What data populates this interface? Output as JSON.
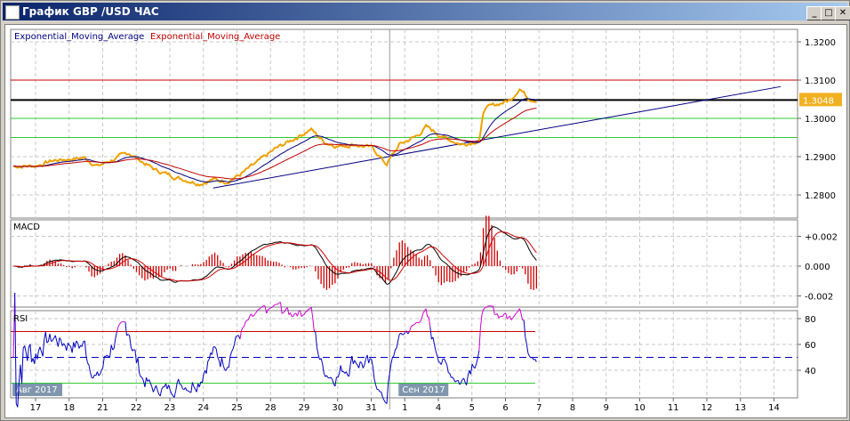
{
  "window": {
    "title": "График GBP /USD  ЧАС",
    "minimize": "_",
    "maximize": "□",
    "close": "✕"
  },
  "colors": {
    "price": "#f0a000",
    "ema_fast": "#000080",
    "ema_slow": "#c00000",
    "rsi_high": "#d000d0",
    "green": "#33cc33",
    "red": "#cc0000"
  },
  "legend": {
    "ema1": "Exponential_Moving_Average",
    "ema2": "Exponential_Moving_Average"
  },
  "chart_data": [
    {
      "type": "line",
      "title": "GBP/USD hourly",
      "ylim": [
        1.277,
        1.3235
      ],
      "yticks": [
        "1.3200",
        "1.3100",
        "1.3000",
        "1.2900",
        "1.2800"
      ],
      "current_price": "1.3048",
      "hlines": [
        {
          "value": 1.31,
          "color": "#cc0000"
        },
        {
          "value": 1.3048,
          "color": "#000000"
        },
        {
          "value": 1.3,
          "color": "#33cc33"
        },
        {
          "value": 1.295,
          "color": "#33cc33"
        }
      ],
      "trendline": [
        [
          5.29,
          1.2818
        ],
        [
          22.2,
          1.3083
        ]
      ],
      "price_points": [
        [
          -0.66,
          1.2875
        ],
        [
          0,
          1.2876
        ],
        [
          0.53,
          1.289
        ],
        [
          1.46,
          1.2897
        ],
        [
          1.85,
          1.2875
        ],
        [
          2.78,
          1.291
        ],
        [
          3.17,
          1.2887
        ],
        [
          3.57,
          1.2865
        ],
        [
          4.23,
          1.2845
        ],
        [
          4.89,
          1.283
        ],
        [
          5.29,
          1.284
        ],
        [
          5.69,
          1.2835
        ],
        [
          6.08,
          1.2852
        ],
        [
          6.61,
          1.2885
        ],
        [
          7.14,
          1.292
        ],
        [
          7.67,
          1.2945
        ],
        [
          8.2,
          1.2972
        ],
        [
          8.6,
          1.2938
        ],
        [
          9.0,
          1.2928
        ],
        [
          9.52,
          1.2932
        ],
        [
          10.05,
          1.2922
        ],
        [
          10.45,
          1.288
        ],
        [
          10.85,
          1.2932
        ],
        [
          11.38,
          1.2955
        ],
        [
          11.64,
          1.2978
        ],
        [
          12.17,
          1.295
        ],
        [
          12.7,
          1.2932
        ],
        [
          13.23,
          1.2943
        ],
        [
          13.36,
          1.3025
        ],
        [
          13.76,
          1.3037
        ],
        [
          14.15,
          1.3048
        ],
        [
          14.42,
          1.308
        ],
        [
          14.68,
          1.3053
        ],
        [
          14.95,
          1.3048
        ]
      ]
    },
    {
      "type": "line",
      "title": "MACD",
      "yticks": [
        "+0.002",
        "0.000",
        "-0.002"
      ],
      "ylim": [
        -0.0025,
        0.0027
      ]
    },
    {
      "type": "line",
      "title": "RSI",
      "yticks": [
        "80",
        "60",
        "40"
      ],
      "ylim": [
        20,
        86
      ],
      "levels": [
        70,
        50,
        30
      ]
    }
  ],
  "xaxis": {
    "labels": [
      "17",
      "18",
      "21",
      "22",
      "23",
      "24",
      "25",
      "28",
      "29",
      "30",
      "31",
      "1",
      "4",
      "5",
      "6",
      "7",
      "8",
      "9",
      "10",
      "11",
      "12",
      "13",
      "14"
    ],
    "month_labels": [
      {
        "text": "Авг 2017",
        "at": 0
      },
      {
        "text": "Сен 2017",
        "at": 11
      }
    ]
  }
}
